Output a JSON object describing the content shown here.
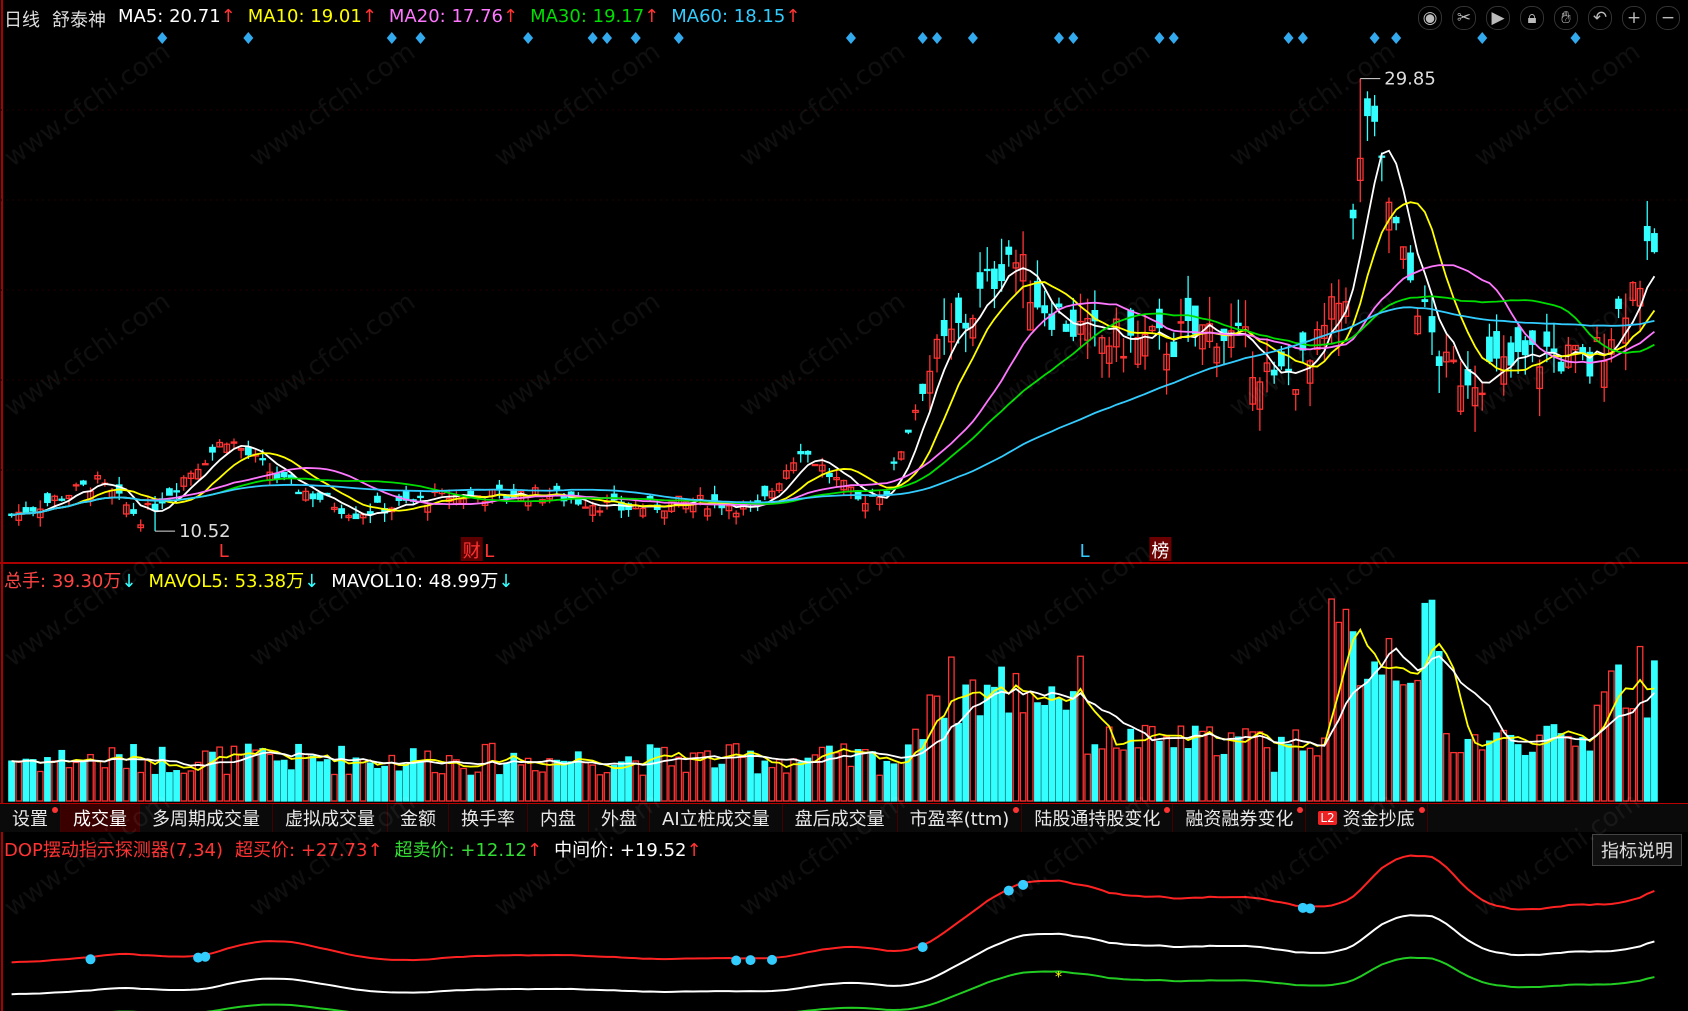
{
  "header": {
    "period": "日线",
    "stock": "舒泰神",
    "ma": [
      {
        "label": "MA5:",
        "value": "20.71",
        "color": "#ffffff",
        "arrow": "↑"
      },
      {
        "label": "MA10:",
        "value": "19.01",
        "color": "#ffff00",
        "arrow": "↑"
      },
      {
        "label": "MA20:",
        "value": "17.76",
        "color": "#ff66ff",
        "arrow": "↑"
      },
      {
        "label": "MA30:",
        "value": "19.17",
        "color": "#00ee00",
        "arrow": "↑"
      },
      {
        "label": "MA60:",
        "value": "18.15",
        "color": "#33ccff",
        "arrow": "↑"
      }
    ]
  },
  "toolbar": {
    "icons": [
      "eye-icon",
      "scissors-icon",
      "play-icon",
      "lock-icon",
      "hand-icon",
      "undo-icon",
      "zoom-in-icon",
      "zoom-out-icon"
    ]
  },
  "price_chart": {
    "high_label": "29.85",
    "low_label": "10.52",
    "markers": [
      "L",
      "财",
      "L",
      "L",
      "榜"
    ]
  },
  "volume_legend": [
    {
      "label": "总手:",
      "value": "39.30万",
      "arrow": "↓",
      "color": "#ff4444"
    },
    {
      "label": "MAVOL5:",
      "value": "53.38万",
      "arrow": "↓",
      "color": "#ffff00"
    },
    {
      "label": "MAVOL10:",
      "value": "48.99万",
      "arrow": "↓",
      "color": "#ffffff"
    }
  ],
  "tabs": [
    {
      "label": "设置",
      "dot": true
    },
    {
      "label": "成交量",
      "active": true
    },
    {
      "label": "多周期成交量"
    },
    {
      "label": "虚拟成交量"
    },
    {
      "label": "金额"
    },
    {
      "label": "换手率"
    },
    {
      "label": "内盘"
    },
    {
      "label": "外盘"
    },
    {
      "label": "AI立桩成交量"
    },
    {
      "label": "盘后成交量"
    },
    {
      "label": "市盈率(ttm)",
      "dot": true
    },
    {
      "label": "陆股通持股变化",
      "dot": true
    },
    {
      "label": "融资融券变化",
      "dot": true
    },
    {
      "label": "资金抄底",
      "dot": true,
      "l2": "L2"
    }
  ],
  "dop": {
    "name": "DOP摆动指示探测器(7,34)",
    "buy_label": "超买价:",
    "buy_value": "+27.73",
    "buy_arrow": "↑",
    "sell_label": "超卖价:",
    "sell_value": "+12.12",
    "sell_arrow": "↑",
    "mid_label": "中间价:",
    "mid_value": "+19.52",
    "mid_arrow": "↑",
    "button": "指标说明"
  },
  "watermark": "www.cfchi.com",
  "colors": {
    "up": "#ff3333",
    "down": "#33ffff",
    "ma5": "#ffffff",
    "ma10": "#ffff00",
    "ma20": "#ff77ff",
    "ma30": "#00dd00",
    "ma60": "#33ccff"
  }
}
